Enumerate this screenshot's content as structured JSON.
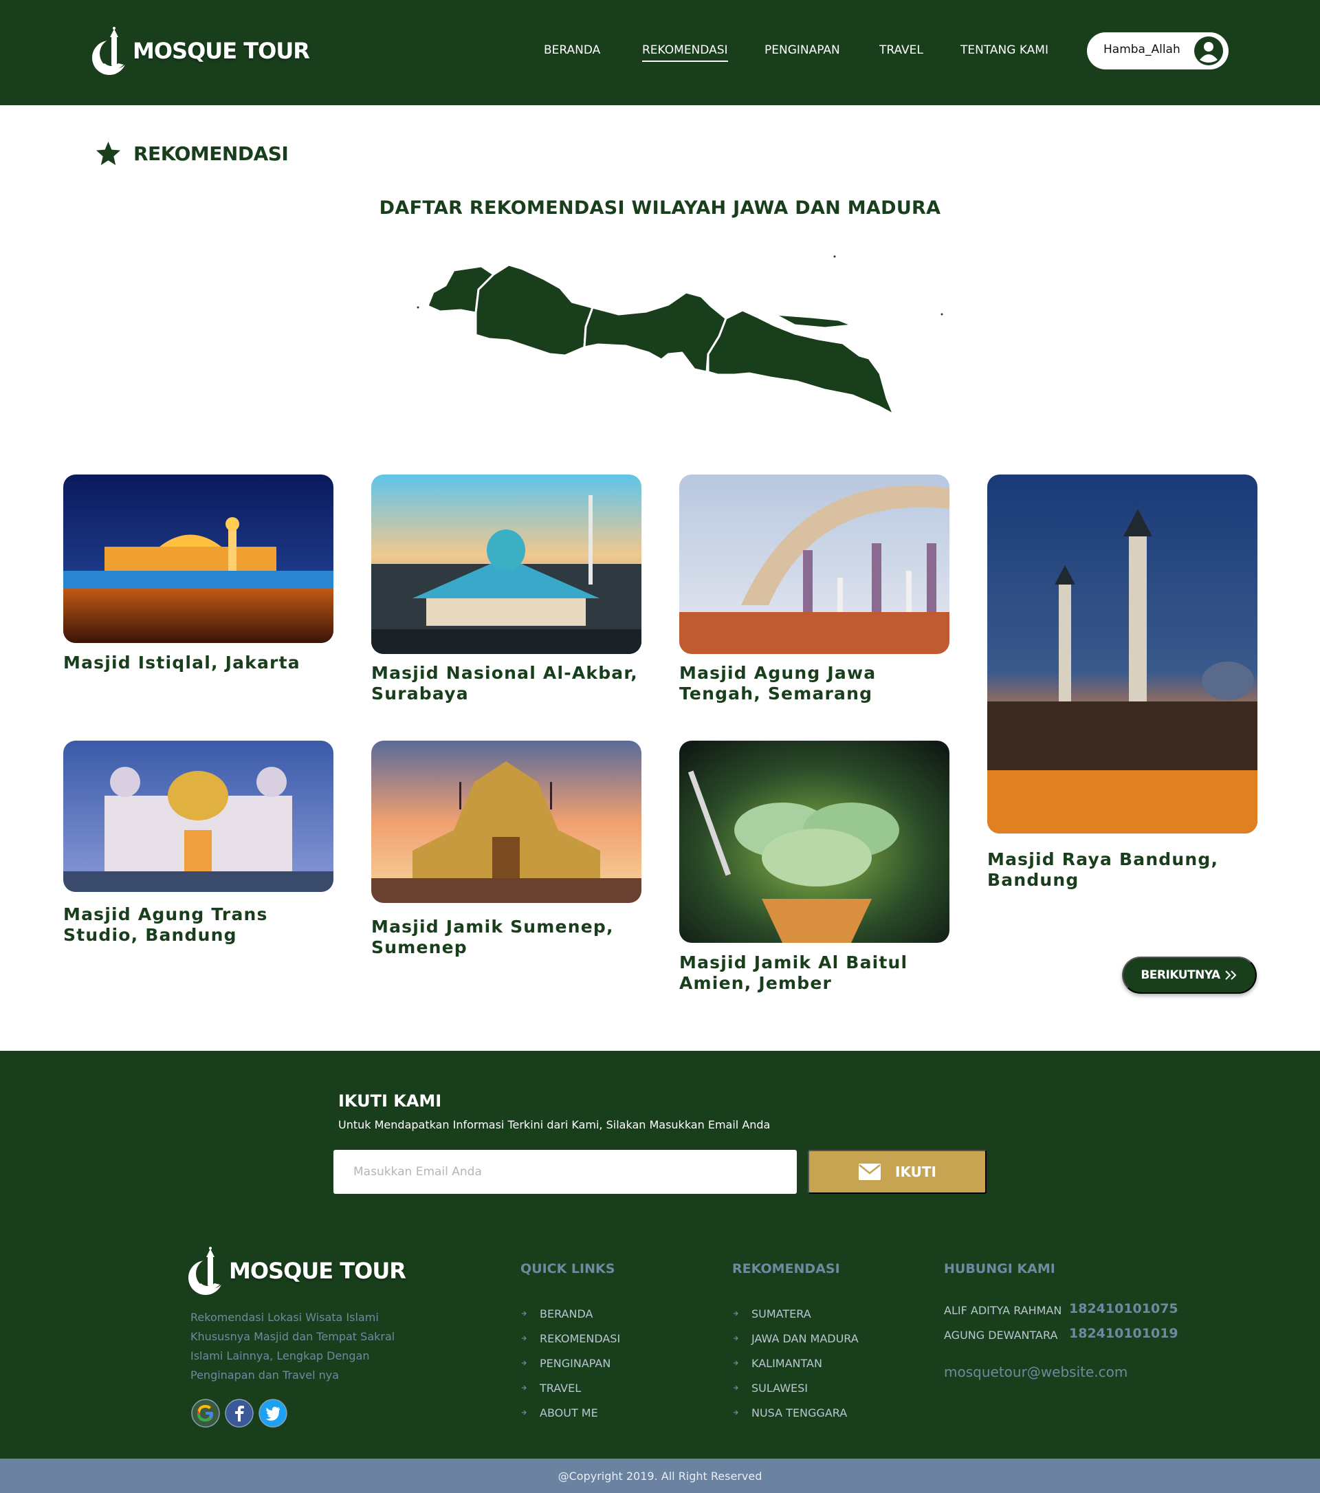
{
  "header": {
    "brand": "MOSQUE TOUR",
    "nav": [
      {
        "label": "BERANDA",
        "active": false
      },
      {
        "label": "REKOMENDASI",
        "active": true
      },
      {
        "label": "PENGINAPAN",
        "active": false
      },
      {
        "label": "TRAVEL",
        "active": false
      },
      {
        "label": "TENTANG KAMI",
        "active": false
      }
    ],
    "user": {
      "name": "Hamba_Allah",
      "icon": "user-circle-icon"
    }
  },
  "section": {
    "icon": "star-icon",
    "title": "REKOMENDASI",
    "map_title": "DAFTAR REKOMENDASI WILAYAH JAWA DAN MADURA"
  },
  "cards": [
    {
      "title": "Masjid Istiqlal, Jakarta"
    },
    {
      "title": "Masjid Nasional Al-Akbar, Surabaya"
    },
    {
      "title": "Masjid Agung Jawa Tengah, Semarang"
    },
    {
      "title": "Masjid Raya Bandung, Bandung"
    },
    {
      "title": "Masjid Agung Trans Studio, Bandung"
    },
    {
      "title": "Masjid Jamik Sumenep, Sumenep"
    },
    {
      "title": "Masjid Jamik Al Baitul Amien, Jember"
    }
  ],
  "next_button": {
    "label": "BERIKUTNYA",
    "icon": "double-chevron-right-icon"
  },
  "newsletter": {
    "title": "IKUTI KAMI",
    "subtitle": "Untuk Mendapatkan Informasi Terkini dari Kami, Silakan Masukkan Email Anda",
    "placeholder": "Masukkan Email Anda",
    "value": "",
    "button_label": "IKUTI",
    "button_icon": "mail-icon"
  },
  "footer": {
    "brand": "MOSQUE TOUR",
    "description": "Rekomendasi Lokasi Wisata Islami Khususnya Masjid dan Tempat Sakral Islami Lainnya, Lengkap Dengan Penginapan dan Travel nya",
    "social": [
      "google-icon",
      "facebook-icon",
      "twitter-icon"
    ],
    "quick_links": {
      "title": "QUICK LINKS",
      "items": [
        "BERANDA",
        "REKOMENDASI",
        "PENGINAPAN",
        "TRAVEL",
        "ABOUT ME"
      ]
    },
    "rekomendasi": {
      "title": "REKOMENDASI",
      "items": [
        "SUMATERA",
        "JAWA DAN MADURA",
        "KALIMANTAN",
        "SULAWESI",
        "NUSA TENGGARA"
      ]
    },
    "contact": {
      "title": "HUBUNGI KAMI",
      "people": [
        {
          "name": "ALIF ADITYA RAHMAN",
          "phone": "182410101075"
        },
        {
          "name": "AGUNG DEWANTARA",
          "phone": "182410101019"
        }
      ],
      "email": "mosquetour@website.com"
    },
    "copyright": "@Copyright 2019. All Right Reserved"
  },
  "colors": {
    "primary": "#183e1c",
    "gold": "#c7a452",
    "muted": "#6f8aa0",
    "copyright_bar": "#6b83a0"
  }
}
